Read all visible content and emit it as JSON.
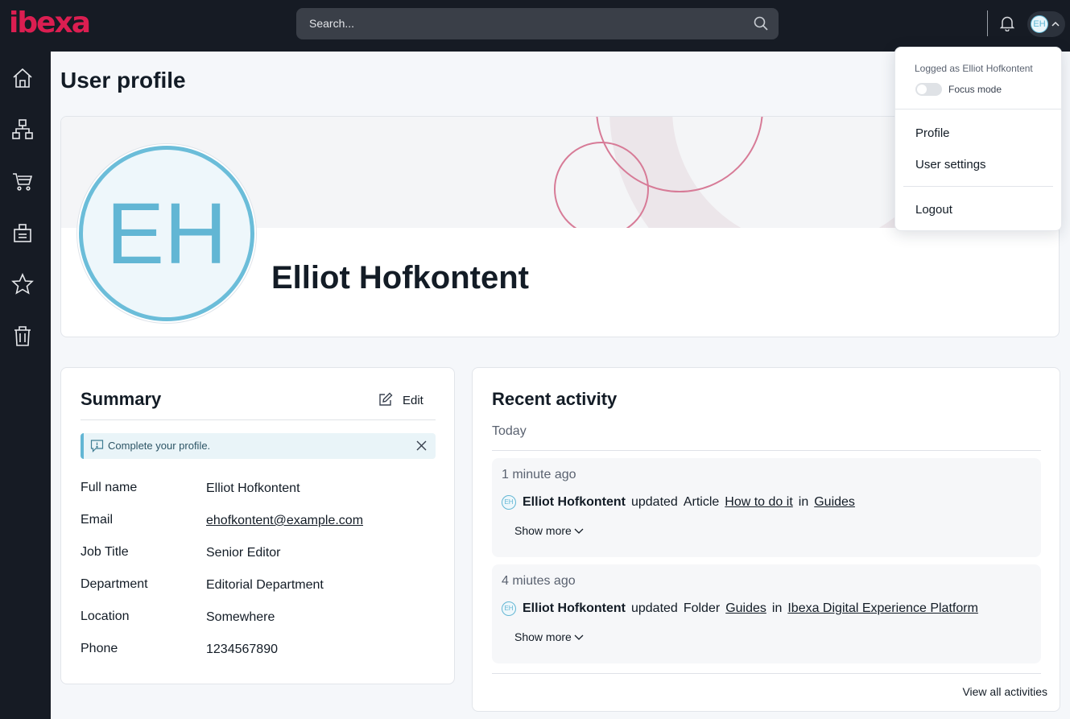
{
  "app": {
    "logo_text": "ibexa"
  },
  "topbar": {
    "search_placeholder": "Search...",
    "user_initials": "EH"
  },
  "sidebar": {
    "items": [
      {
        "name": "home-icon"
      },
      {
        "name": "content-tree-icon"
      },
      {
        "name": "cart-icon"
      },
      {
        "name": "catalog-icon"
      },
      {
        "name": "star-icon"
      },
      {
        "name": "trash-icon"
      }
    ]
  },
  "page": {
    "title": "User profile"
  },
  "profile": {
    "initials": "EH",
    "name": "Elliot Hofkontent"
  },
  "summary": {
    "title": "Summary",
    "edit_label": "Edit",
    "alert": "Complete your profile.",
    "fields": [
      {
        "label": "Full name",
        "value": "Elliot Hofkontent"
      },
      {
        "label": "Email",
        "value": "ehofkontent@example.com"
      },
      {
        "label": "Job Title",
        "value": "Senior Editor"
      },
      {
        "label": "Department",
        "value": "Editorial Department"
      },
      {
        "label": "Location",
        "value": "Somewhere"
      },
      {
        "label": "Phone",
        "value": "1234567890"
      }
    ]
  },
  "activity": {
    "title": "Recent activity",
    "group_label": "Today",
    "items": [
      {
        "time": "1 minute ago",
        "initials": "EH",
        "user": "Elliot Hofkontent",
        "action": "updated",
        "type": "Article",
        "target": "How to do it",
        "preposition": "in",
        "location": "Guides",
        "show_more": "Show more"
      },
      {
        "time": "4 miutes ago",
        "initials": "EH",
        "user": "Elliot Hofkontent",
        "action": "updated",
        "type": "Folder",
        "target": "Guides",
        "preposition": "in",
        "location": "Ibexa Digital Experience Platform",
        "show_more": "Show more"
      }
    ],
    "view_all": "View all activities"
  },
  "user_menu": {
    "logged_as": "Logged as Elliot Hofkontent",
    "focus_mode_label": "Focus mode",
    "focus_mode_on": false,
    "items": [
      "Profile",
      "User settings",
      "Logout"
    ]
  },
  "colors": {
    "brand": "#db1e51",
    "accent": "#62b6d4",
    "dark": "#161b24"
  }
}
